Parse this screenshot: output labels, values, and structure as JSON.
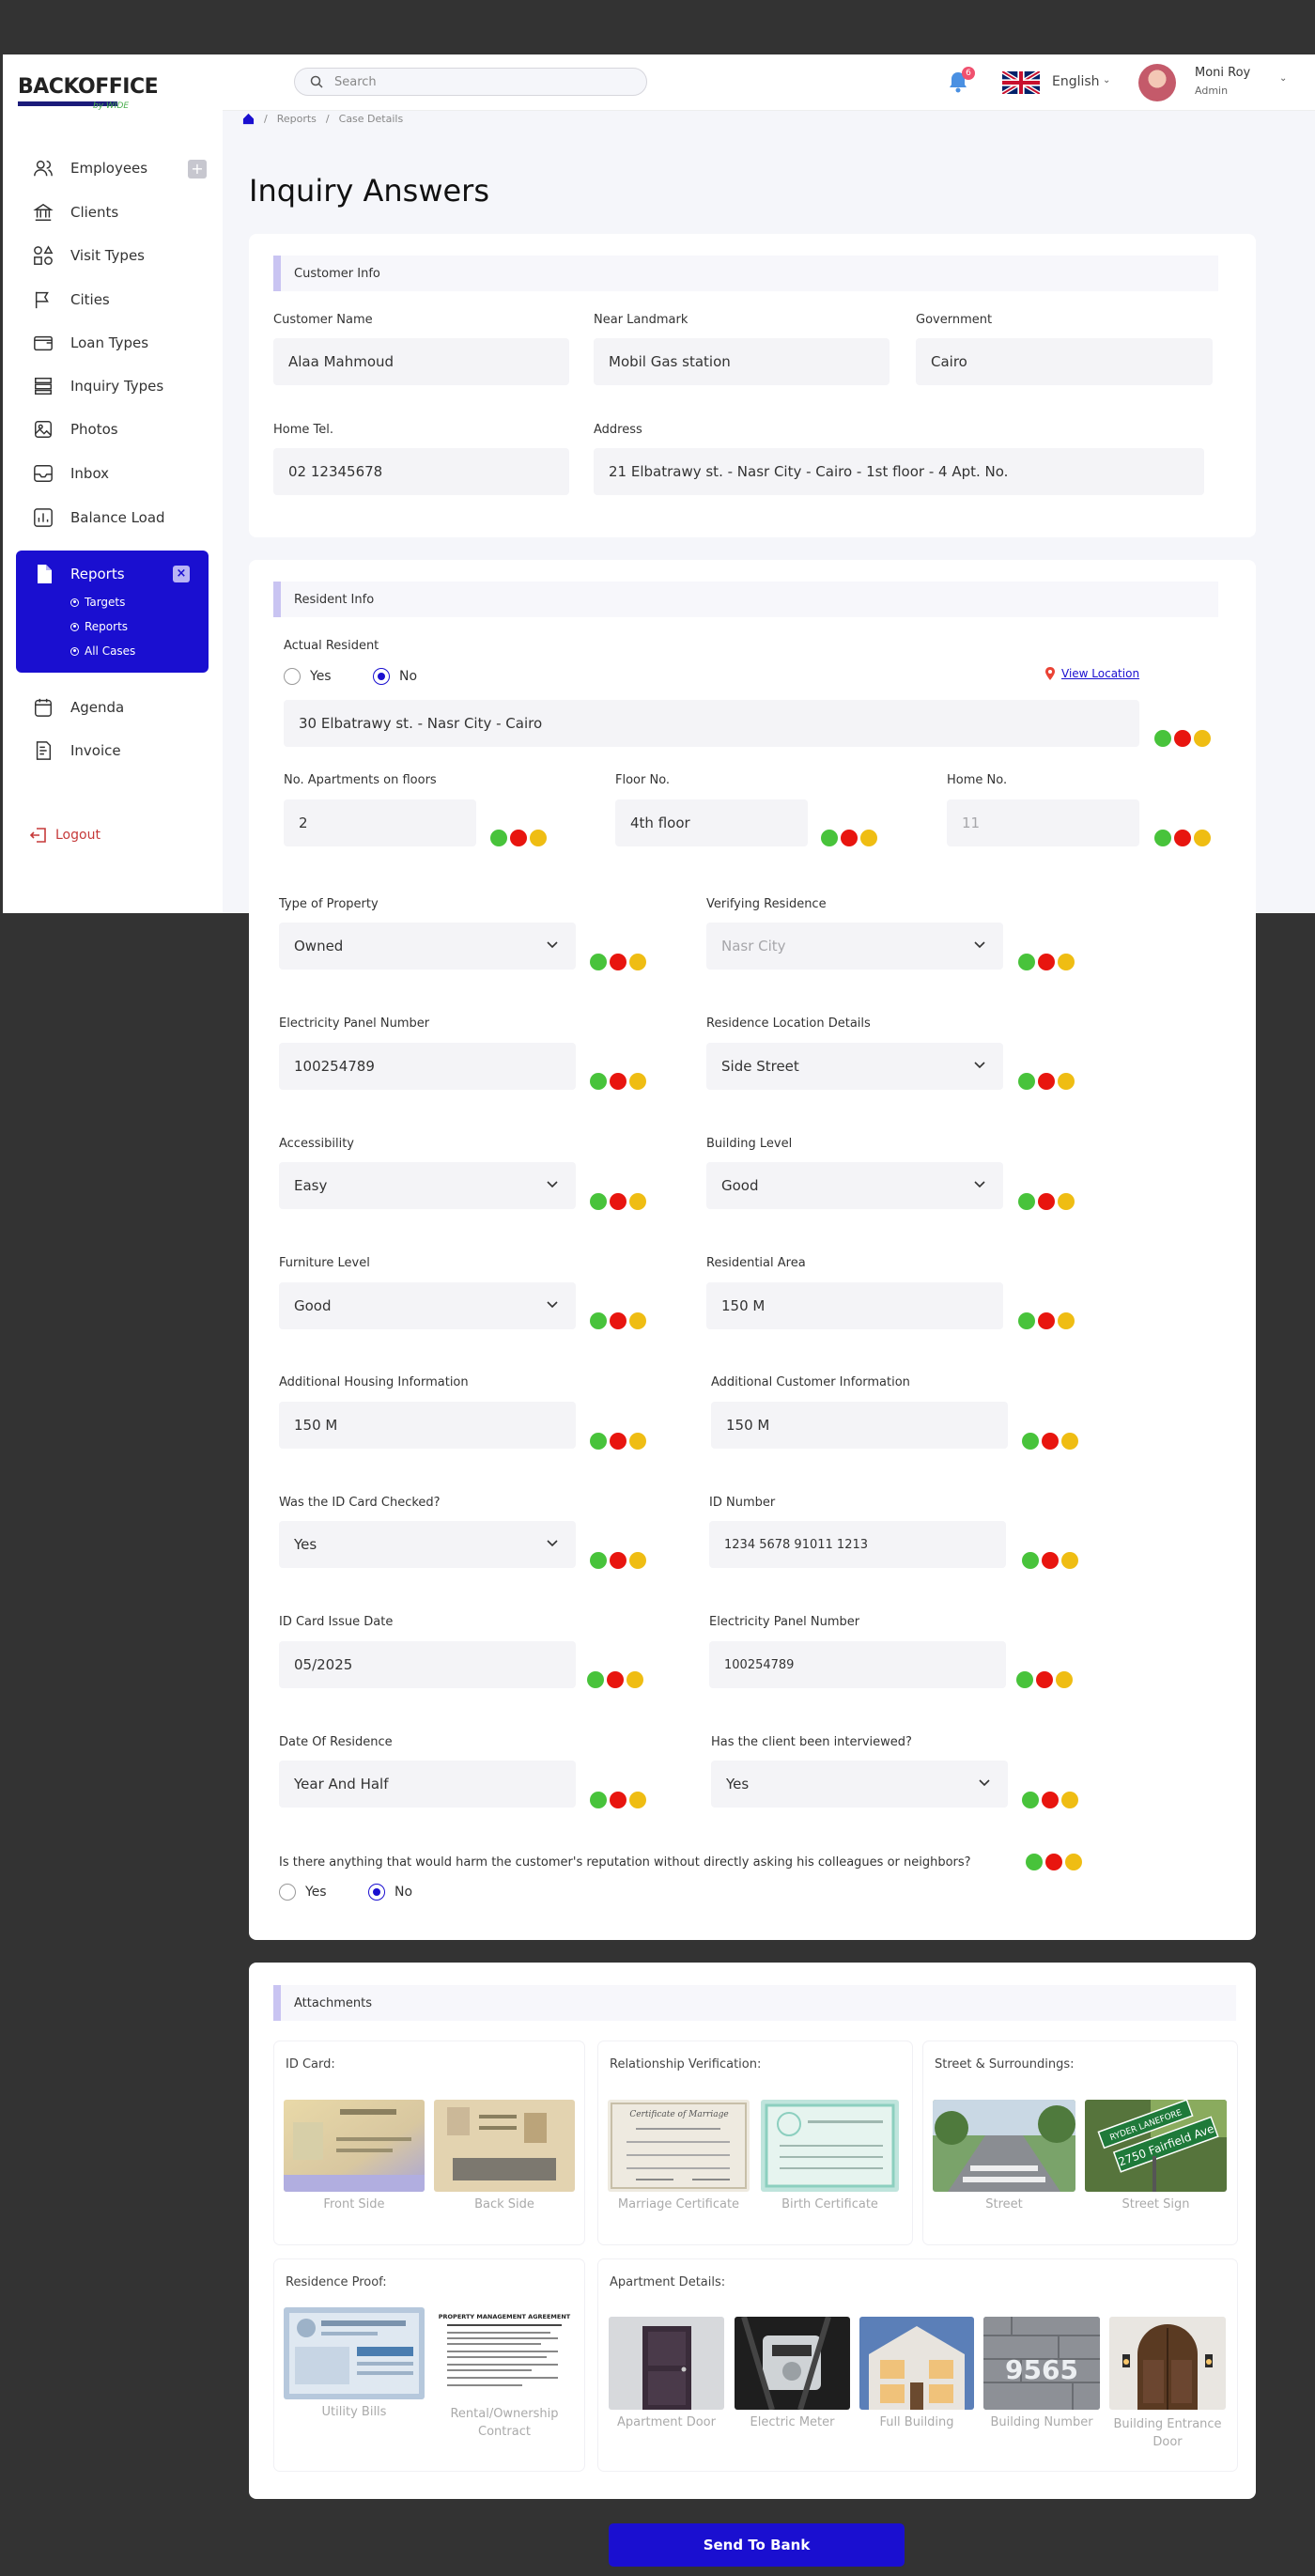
{
  "brand": {
    "logo": "BACKOFFICE",
    "logo_sub": "by WIDE"
  },
  "sidebar": {
    "items": [
      {
        "label": "Employees",
        "icon": "users-icon"
      },
      {
        "label": "Clients",
        "icon": "bank-icon"
      },
      {
        "label": "Visit Types",
        "icon": "shapes-icon"
      },
      {
        "label": "Cities",
        "icon": "flag-icon"
      },
      {
        "label": "Loan Types",
        "icon": "wallet-icon"
      },
      {
        "label": "Inquiry Types",
        "icon": "layers-icon"
      },
      {
        "label": "Photos",
        "icon": "image-icon"
      },
      {
        "label": "Inbox",
        "icon": "inbox-icon"
      },
      {
        "label": "Balance Load",
        "icon": "chart-icon"
      }
    ],
    "reports": {
      "label": "Reports",
      "sub": [
        "Targets",
        "Reports",
        "All Cases"
      ]
    },
    "items_after": [
      {
        "label": "Agenda",
        "icon": "calendar-icon"
      },
      {
        "label": "Invoice",
        "icon": "invoice-icon"
      }
    ],
    "logout": "Logout"
  },
  "topbar": {
    "search_placeholder": "Search",
    "notifications": "6",
    "language": "English",
    "user_name": "Moni Roy",
    "user_role": "Admin"
  },
  "breadcrumb": [
    "Reports",
    "Case Details"
  ],
  "page_title": "Inquiry Answers",
  "customer_info": {
    "title": "Customer Info",
    "customer_name": {
      "label": "Customer Name",
      "value": "Alaa Mahmoud"
    },
    "near_landmark": {
      "label": "Near Landmark",
      "value": "Mobil Gas station"
    },
    "government": {
      "label": "Government",
      "value": "Cairo"
    },
    "home_tel": {
      "label": "Home Tel.",
      "value": "02 12345678"
    },
    "address": {
      "label": "Address",
      "value": "21 Elbatrawy st. - Nasr City - Cairo - 1st floor - 4 Apt. No."
    }
  },
  "resident_info": {
    "title": "Resident Info",
    "actual_resident": {
      "label": "Actual Resident",
      "yes": "Yes",
      "no": "No",
      "selected": "No",
      "address": "30 Elbatrawy st. - Nasr City - Cairo"
    },
    "view_location": "View Location",
    "apartments": {
      "label": "No. Apartments on floors",
      "value": "2"
    },
    "floor_no": {
      "label": "Floor No.",
      "value": "4th floor"
    },
    "home_no": {
      "label": "Home No.",
      "placeholder": "11"
    },
    "type_of_property": {
      "label": "Type of Property",
      "value": "Owned"
    },
    "verifying_residence": {
      "label": "Verifying Residence",
      "placeholder": "Nasr City"
    },
    "electricity_panel_1": {
      "label": "Electricity Panel Number",
      "value": "100254789"
    },
    "residence_location": {
      "label": "Residence Location Details",
      "value": "Side Street"
    },
    "accessibility": {
      "label": "Accessibility",
      "value": "Easy"
    },
    "building_level": {
      "label": "Building Level",
      "value": "Good"
    },
    "furniture_level": {
      "label": "Furniture Level",
      "value": "Good"
    },
    "residential_area": {
      "label": "Residential Area",
      "value": "150 M"
    },
    "additional_housing": {
      "label": "Additional Housing Information",
      "value": "150 M"
    },
    "additional_customer": {
      "label": "Additional Customer Information",
      "value": "150 M"
    },
    "id_checked": {
      "label": "Was the ID Card Checked?",
      "value": "Yes"
    },
    "id_number": {
      "label": "ID Number",
      "value": "1234 5678 91011 1213"
    },
    "id_issue_date": {
      "label": "ID Card Issue Date",
      "value": "05/2025"
    },
    "electricity_panel_2": {
      "label": "Electricity Panel Number",
      "value": "100254789"
    },
    "date_of_residence": {
      "label": "Date Of Residence",
      "value": "Year And Half"
    },
    "interviewed": {
      "label": "Has the client been interviewed?",
      "value": "Yes"
    },
    "reputation": {
      "label": "Is there anything that would harm the customer's reputation without directly asking his colleagues or neighbors?",
      "yes": "Yes",
      "no": "No",
      "selected": "No"
    }
  },
  "attachments": {
    "title": "Attachments",
    "id_card": {
      "title": "ID Card:",
      "items": [
        "Front Side",
        "Back Side"
      ]
    },
    "relationship": {
      "title": "Relationship Verification:",
      "items": [
        "Marriage Certificate",
        "Birth Certificate"
      ]
    },
    "street": {
      "title": "Street & Surroundings:",
      "items": [
        "Street",
        "Street Sign"
      ]
    },
    "residence_proof": {
      "title": "Residence Proof:",
      "items": [
        "Utility Bills",
        "Rental/Ownership Contract"
      ]
    },
    "apartment": {
      "title": "Apartment Details:",
      "items": [
        "Apartment Door",
        "Electric Meter",
        "Full Building",
        "Building Number",
        "Building Entrance Door"
      ]
    }
  },
  "street_sign_text": {
    "top": "RYDER LANEFORE",
    "bottom": "2750 Fairfield Ave"
  },
  "building_number_text": "9565",
  "contract_header": "PROPERTY MANAGEMENT AGREEMENT",
  "certificate_header": "Certificate of Marriage",
  "send_button": "Send To Bank",
  "colors": {
    "accent": "#1a0fd0",
    "green": "#48c33b",
    "red": "#e8150f",
    "yellow": "#efbd13"
  }
}
